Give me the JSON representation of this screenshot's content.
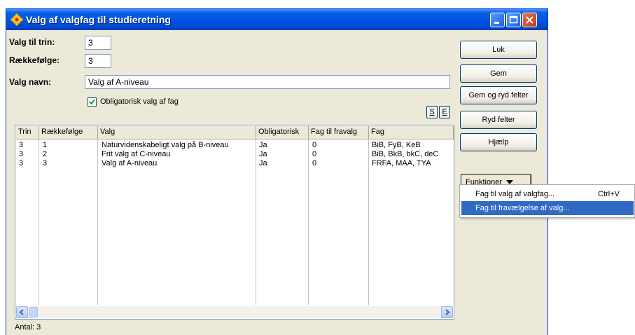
{
  "window": {
    "title": "Valg af valgfag til studieretning"
  },
  "form": {
    "trin_label": "Valg til trin:",
    "trin_value": "3",
    "raekkefolge_label": "Rækkefølge:",
    "raekkefolge_value": "3",
    "navn_label": "Valg navn:",
    "navn_value": "Valg af A-niveau",
    "obligatorisk_label": "Obligatorisk valg af fag",
    "obligatorisk_checked": true,
    "s_button": "S",
    "e_button": "E"
  },
  "table": {
    "columns": [
      "Trin",
      "Rækkefølge",
      "Valg",
      "Obligatorisk",
      "Fag til fravalg",
      "Fag"
    ],
    "rows": [
      [
        "3",
        "1",
        "Naturvidenskabeligt valg på B-niveau",
        "Ja",
        "0",
        "BiB, FyB, KeB"
      ],
      [
        "3",
        "2",
        "Frit valg af C-niveau",
        "Ja",
        "0",
        "BiB, BkB, bkC, deC"
      ],
      [
        "3",
        "3",
        "Valg af A-niveau",
        "Ja",
        "0",
        "FRFA, MAA, TYA"
      ]
    ]
  },
  "status": {
    "count": "Antal: 3"
  },
  "buttons": {
    "luk": "Luk",
    "gem": "Gem",
    "gem_ryd": "Gem og ryd felter",
    "ryd": "Ryd felter",
    "hjaelp": "Hjælp",
    "funktioner": "Funktioner"
  },
  "menu": {
    "items": [
      {
        "label": "Fag til valg af valgfag...",
        "shortcut": "Ctrl+V"
      },
      {
        "label": "Fag til fravælgelse af valg...",
        "shortcut": ""
      }
    ]
  },
  "colors": {
    "titlebar": "#0055e5",
    "window_bg": "#ece9d8",
    "menu_highlight": "#316ac5",
    "close_button": "#c2391a"
  },
  "icons": [
    "app-gear-icon",
    "minimize-icon",
    "maximize-icon",
    "close-icon",
    "checkmark-icon",
    "dropdown-arrow-icon",
    "scroll-left-icon",
    "scroll-right-icon"
  ]
}
